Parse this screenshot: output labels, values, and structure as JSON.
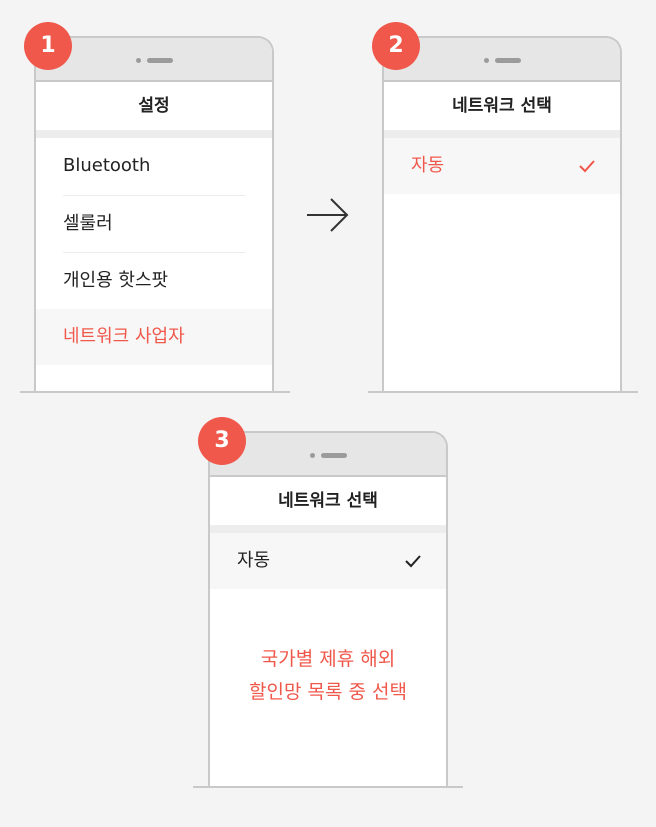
{
  "colors": {
    "accent": "#f0584b",
    "frame": "#c9c9c9",
    "phone_top": "#e6e6e6",
    "background": "#f4f4f4"
  },
  "steps": [
    {
      "number": "1",
      "title": "설정",
      "items": [
        "Bluetooth",
        "셀룰러",
        "개인용 핫스팟",
        "네트워크 사업자"
      ],
      "highlighted_item": "네트워크 사업자"
    },
    {
      "number": "2",
      "title": "네트워크 선택",
      "option": "자동",
      "option_checked": true,
      "option_state": "accent"
    },
    {
      "number": "3",
      "title": "네트워크 선택",
      "option": "자동",
      "option_checked": true,
      "option_state": "default",
      "note_lines": [
        "국가별 제휴 해외",
        "할인망 목록 중 선택"
      ]
    }
  ],
  "icons": {
    "arrow": "right-arrow-icon",
    "check": "checkmark-icon"
  }
}
